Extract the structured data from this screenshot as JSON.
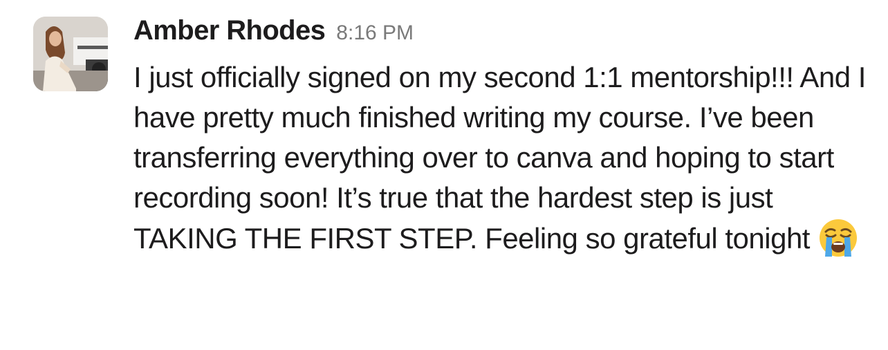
{
  "message": {
    "sender": "Amber Rhodes",
    "timestamp": "8:16 PM",
    "avatar_icon": "user-photo",
    "body": "I just officially signed on my second 1:1 mentorship!!! And I have pretty much finished writing my course. I’ve been transferring everything over to canva and hoping to start recording soon! It’s true that the hardest step is just TAKING THE FIRST STEP. Feeling so grateful tonight",
    "emoji": "loudly-crying-face"
  }
}
